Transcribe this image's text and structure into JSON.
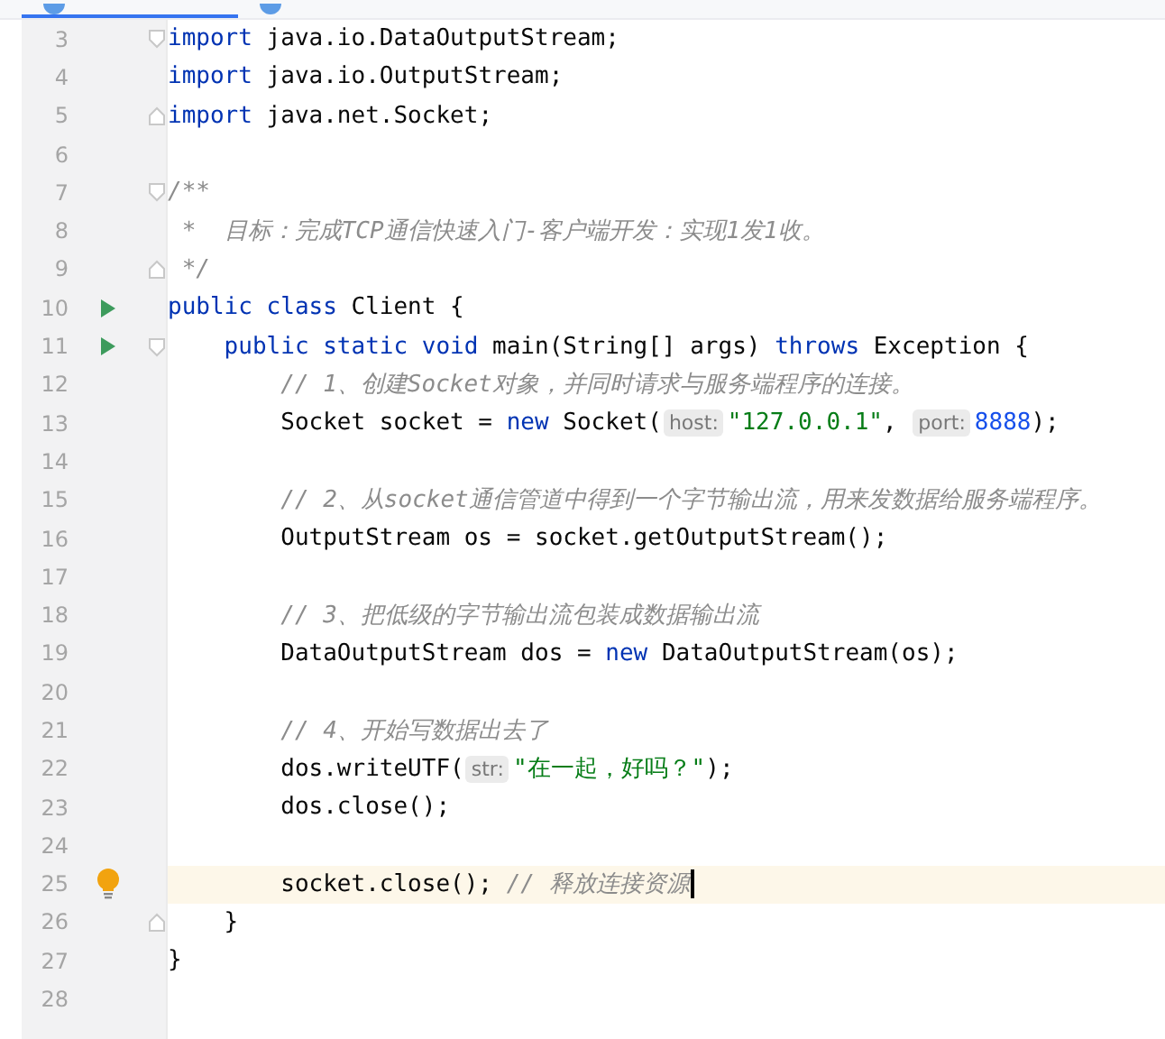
{
  "tabs": [
    {
      "selected": true
    },
    {
      "selected": false
    }
  ],
  "lines": [
    {
      "number": "3",
      "fold_marker": {
        "kind": "start"
      },
      "tokens": [
        {
          "kind": "keyword",
          "text": "import"
        },
        {
          "kind": "plain",
          "text": " java.io.DataOutputStream;"
        }
      ]
    },
    {
      "number": "4",
      "tokens": [
        {
          "kind": "keyword",
          "text": "import"
        },
        {
          "kind": "plain",
          "text": " java.io.OutputStream;"
        }
      ]
    },
    {
      "number": "5",
      "fold_marker": {
        "kind": "end"
      },
      "tokens": [
        {
          "kind": "keyword",
          "text": "import"
        },
        {
          "kind": "plain",
          "text": " java.net.Socket;"
        }
      ]
    },
    {
      "number": "6"
    },
    {
      "number": "7",
      "fold_marker": {
        "kind": "start"
      },
      "tokens": [
        {
          "kind": "comment",
          "text": "/**"
        }
      ]
    },
    {
      "number": "8",
      "tokens": [
        {
          "kind": "comment",
          "text": " *  目标：完成TCP通信快速入门-客户端开发：实现1发1收。"
        }
      ]
    },
    {
      "number": "9",
      "fold_marker": {
        "kind": "end"
      },
      "tokens": [
        {
          "kind": "comment",
          "text": " */"
        }
      ]
    },
    {
      "number": "10",
      "gutter_icon": {
        "kind": "run"
      },
      "tokens": [
        {
          "kind": "keyword",
          "text": "public class"
        },
        {
          "kind": "plain",
          "text": " Client {"
        }
      ]
    },
    {
      "number": "11",
      "gutter_icon": {
        "kind": "run"
      },
      "fold_marker": {
        "kind": "start"
      },
      "tokens": [
        {
          "kind": "keyword",
          "text": "    public static void"
        },
        {
          "kind": "plain",
          "text": " main(String[] args) "
        },
        {
          "kind": "keyword",
          "text": "throws"
        },
        {
          "kind": "plain",
          "text": " Exception {"
        }
      ]
    },
    {
      "number": "12",
      "tokens": [
        {
          "kind": "comment",
          "text": "        // 1、创建Socket对象，并同时请求与服务端程序的连接。"
        }
      ]
    },
    {
      "number": "13",
      "tokens": [
        {
          "kind": "plain",
          "text": "        Socket socket = "
        },
        {
          "kind": "keyword",
          "text": "new"
        },
        {
          "kind": "plain",
          "text": " Socket("
        },
        {
          "kind": "hint",
          "text": "host:"
        },
        {
          "kind": "string",
          "text": "\"127.0.0.1\""
        },
        {
          "kind": "plain",
          "text": ", "
        },
        {
          "kind": "hint",
          "text": "port:"
        },
        {
          "kind": "number",
          "text": "8888"
        },
        {
          "kind": "plain",
          "text": ");"
        }
      ]
    },
    {
      "number": "14"
    },
    {
      "number": "15",
      "tokens": [
        {
          "kind": "comment",
          "text": "        // 2、从socket通信管道中得到一个字节输出流，用来发数据给服务端程序。"
        }
      ]
    },
    {
      "number": "16",
      "tokens": [
        {
          "kind": "plain",
          "text": "        OutputStream os = socket.getOutputStream();"
        }
      ]
    },
    {
      "number": "17"
    },
    {
      "number": "18",
      "tokens": [
        {
          "kind": "comment",
          "text": "        // 3、把低级的字节输出流包装成数据输出流"
        }
      ]
    },
    {
      "number": "19",
      "tokens": [
        {
          "kind": "plain",
          "text": "        DataOutputStream dos = "
        },
        {
          "kind": "keyword",
          "text": "new"
        },
        {
          "kind": "plain",
          "text": " DataOutputStream(os);"
        }
      ]
    },
    {
      "number": "20"
    },
    {
      "number": "21",
      "tokens": [
        {
          "kind": "comment",
          "text": "        // 4、开始写数据出去了"
        }
      ]
    },
    {
      "number": "22",
      "tokens": [
        {
          "kind": "plain",
          "text": "        dos.writeUTF("
        },
        {
          "kind": "hint",
          "text": "str:"
        },
        {
          "kind": "string",
          "text": "\"在一起，好吗？\""
        },
        {
          "kind": "plain",
          "text": ");"
        }
      ]
    },
    {
      "number": "23",
      "tokens": [
        {
          "kind": "plain",
          "text": "        dos.close();"
        }
      ]
    },
    {
      "number": "24"
    },
    {
      "number": "25",
      "current": true,
      "caret": true,
      "gutter_icon": {
        "kind": "bulb"
      },
      "tokens": [
        {
          "kind": "plain",
          "text": "        socket.close(); "
        },
        {
          "kind": "comment",
          "text": "// 释放连接资源"
        }
      ]
    },
    {
      "number": "26",
      "fold_marker": {
        "kind": "end"
      },
      "tokens": [
        {
          "kind": "plain",
          "text": "    }"
        }
      ]
    },
    {
      "number": "27",
      "tokens": [
        {
          "kind": "plain",
          "text": "}"
        }
      ]
    },
    {
      "number": "28"
    }
  ]
}
